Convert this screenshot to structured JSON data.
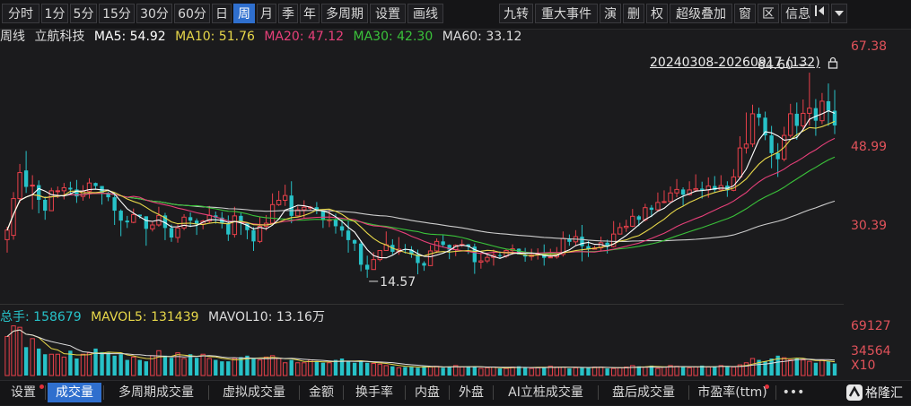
{
  "toolbar": {
    "left_items": [
      "分时",
      "1分",
      "5分",
      "15分",
      "30分",
      "60分",
      "日",
      "周",
      "月",
      "季",
      "年",
      "多周期",
      "设置",
      "画线"
    ],
    "active": "周",
    "right_items": [
      "九转",
      "重大事件",
      "演",
      "删",
      "权",
      "超级叠加",
      "窗",
      "区",
      "信息"
    ]
  },
  "legend": {
    "period": "周线",
    "name": "立航科技",
    "ma5": "MA5: 54.92",
    "ma10": "MA10: 51.76",
    "ma20": "MA20: 47.12",
    "ma30": "MA30: 42.30",
    "ma60": "MA60: 33.12"
  },
  "range_label": "20240308-20260917 (132)",
  "price_axis": [
    "67.38",
    "48.99",
    "30.39"
  ],
  "annotations": {
    "high": "64.60",
    "low": "14.57"
  },
  "volume": {
    "total": "总手: 158679",
    "mavol5": "MAVOL5: 131439",
    "mavol10": "MAVOL10: 13.16万",
    "axis": [
      "69127",
      "34564",
      "X10"
    ]
  },
  "bottom_tabs": [
    "设置",
    "成交量",
    "多周期成交量",
    "虚拟成交量",
    "金额",
    "换手率",
    "内盘",
    "外盘",
    "AI立桩成交量",
    "盘后成交量",
    "市盈率(ttm)",
    "•••"
  ],
  "bottom_active": "成交量",
  "logo_text": "格隆汇",
  "colors": {
    "up": "#e8404a",
    "down": "#27c2c8",
    "ma5": "#ffffff",
    "ma10": "#e8d84a",
    "ma20": "#e8407a",
    "ma30": "#3ac23a",
    "ma60": "#cccccc"
  },
  "chart_data": {
    "type": "candlestick",
    "ylim": [
      12,
      70
    ],
    "x_count": 132,
    "points": [
      [
        0,
        26.0,
        28.2,
        23.0,
        29.0
      ],
      [
        1,
        27.0,
        35.5,
        26.0,
        37.0
      ],
      [
        2,
        35.5,
        41.5,
        34.5,
        43.5
      ],
      [
        3,
        42.0,
        38.2,
        36.8,
        46.5
      ],
      [
        4,
        38.6,
        38.6,
        33.0,
        40.9
      ],
      [
        5,
        38.6,
        35.2,
        32.1,
        39.7
      ],
      [
        6,
        35.2,
        32.7,
        30.6,
        36.0
      ],
      [
        7,
        32.7,
        37.3,
        32.6,
        38.0
      ],
      [
        8,
        37.3,
        37.3,
        35.6,
        38.3
      ],
      [
        9,
        37.3,
        38.0,
        35.3,
        39.1
      ],
      [
        10,
        38.0,
        37.6,
        36.7,
        39.4
      ],
      [
        11,
        37.6,
        36.0,
        34.5,
        39.8
      ],
      [
        12,
        36.0,
        37.2,
        35.0,
        38.6
      ],
      [
        13,
        37.2,
        39.1,
        35.5,
        40.2
      ],
      [
        14,
        39.1,
        38.4,
        37.8,
        39.2
      ],
      [
        15,
        38.4,
        36.8,
        34.1,
        37.0
      ],
      [
        16,
        36.8,
        35.8,
        34.9,
        37.1
      ],
      [
        17,
        35.8,
        32.7,
        29.4,
        36.9
      ],
      [
        18,
        32.7,
        30.4,
        26.8,
        33.0
      ],
      [
        19,
        30.4,
        30.0,
        28.7,
        31.5
      ],
      [
        20,
        30.0,
        31.8,
        29.8,
        33.2
      ],
      [
        21,
        31.8,
        31.4,
        30.9,
        31.5
      ],
      [
        22,
        31.4,
        28.5,
        24.6,
        31.4
      ],
      [
        23,
        28.5,
        29.4,
        27.9,
        30.1
      ],
      [
        24,
        29.4,
        31.6,
        29.0,
        33.6
      ],
      [
        25,
        31.6,
        28.7,
        25.9,
        32.2
      ],
      [
        26,
        28.7,
        26.5,
        25.5,
        29.5
      ],
      [
        27,
        26.5,
        28.7,
        25.3,
        29.5
      ],
      [
        28,
        28.7,
        31.2,
        28.2,
        31.9
      ],
      [
        29,
        31.2,
        30.4,
        28.9,
        32.3
      ],
      [
        30,
        30.4,
        29.6,
        27.1,
        30.9
      ],
      [
        31,
        29.6,
        30.3,
        28.4,
        30.6
      ],
      [
        32,
        30.3,
        31.6,
        29.7,
        33.8
      ],
      [
        33,
        31.6,
        31.1,
        29.7,
        32.5
      ],
      [
        34,
        31.1,
        29.8,
        28.6,
        32.4
      ],
      [
        35,
        29.8,
        27.2,
        25.7,
        31.6
      ],
      [
        36,
        27.2,
        31.5,
        26.5,
        33.6
      ],
      [
        37,
        31.5,
        29.8,
        27.1,
        32.2
      ],
      [
        38,
        29.8,
        28.2,
        26.1,
        30.0
      ],
      [
        39,
        28.2,
        25.6,
        23.4,
        28.9
      ],
      [
        40,
        25.6,
        29.1,
        25.2,
        31.2
      ],
      [
        41,
        29.1,
        29.8,
        28.1,
        31.7
      ],
      [
        42,
        29.8,
        34.1,
        29.5,
        36.7
      ],
      [
        43,
        34.1,
        35.1,
        33.8,
        37.3
      ],
      [
        44,
        35.1,
        36.2,
        33.8,
        38.7
      ],
      [
        45,
        36.2,
        31.5,
        29.8,
        39.5
      ],
      [
        46,
        31.5,
        32.9,
        31.3,
        33.7
      ],
      [
        47,
        32.9,
        33.5,
        31.0,
        35.1
      ],
      [
        48,
        33.5,
        33.5,
        32.6,
        33.8
      ],
      [
        49,
        33.5,
        32.8,
        31.9,
        34.7
      ],
      [
        50,
        32.8,
        30.5,
        28.7,
        31.6
      ],
      [
        51,
        30.5,
        30.6,
        28.9,
        33.0
      ],
      [
        52,
        30.6,
        29.1,
        27.4,
        32.0
      ],
      [
        53,
        29.1,
        28.1,
        26.7,
        30.6
      ],
      [
        54,
        28.1,
        25.9,
        23.0,
        30.5
      ],
      [
        55,
        25.9,
        25.1,
        23.4,
        26.1
      ],
      [
        56,
        25.1,
        20.2,
        18.7,
        25.8
      ],
      [
        57,
        20.2,
        19.1,
        17.2,
        22.3
      ],
      [
        58,
        19.1,
        21.4,
        20.1,
        23.1
      ],
      [
        59,
        21.4,
        23.5,
        21.0,
        23.6
      ],
      [
        60,
        23.5,
        24.8,
        24.3,
        27.9
      ],
      [
        61,
        24.8,
        23.2,
        22.6,
        26.1
      ],
      [
        62,
        23.2,
        23.8,
        22.5,
        26.6
      ],
      [
        63,
        23.8,
        23.7,
        22.8,
        25.0
      ],
      [
        64,
        23.7,
        22.6,
        21.8,
        24.5
      ],
      [
        65,
        22.6,
        20.6,
        18.0,
        23.7
      ],
      [
        66,
        20.6,
        20.0,
        18.8,
        21.0
      ],
      [
        67,
        20.0,
        23.4,
        19.9,
        24.7
      ],
      [
        68,
        23.4,
        25.6,
        22.9,
        26.3
      ],
      [
        69,
        25.6,
        24.8,
        24.2,
        27.0
      ],
      [
        70,
        24.8,
        23.7,
        21.5,
        24.9
      ],
      [
        71,
        23.7,
        24.7,
        22.2,
        24.9
      ],
      [
        72,
        24.7,
        24.9,
        24.3,
        26.0
      ],
      [
        73,
        24.9,
        24.4,
        22.7,
        25.0
      ],
      [
        74,
        24.4,
        20.8,
        18.1,
        25.1
      ],
      [
        75,
        20.8,
        21.1,
        19.3,
        22.9
      ],
      [
        76,
        21.1,
        21.9,
        20.6,
        22.6
      ],
      [
        77,
        21.9,
        22.4,
        20.0,
        23.7
      ],
      [
        78,
        22.4,
        22.2,
        21.6,
        23.3
      ],
      [
        79,
        22.2,
        23.5,
        21.8,
        23.8
      ],
      [
        80,
        23.5,
        23.9,
        22.5,
        24.9
      ],
      [
        81,
        23.9,
        22.6,
        22.6,
        24.0
      ],
      [
        82,
        22.6,
        22.1,
        20.9,
        24.1
      ],
      [
        83,
        22.1,
        22.5,
        21.2,
        23.9
      ],
      [
        84,
        22.5,
        22.7,
        21.4,
        24.0
      ],
      [
        85,
        22.7,
        21.8,
        20.0,
        24.9
      ],
      [
        86,
        21.8,
        22.0,
        21.8,
        23.9
      ],
      [
        87,
        22.0,
        22.6,
        21.6,
        24.3
      ],
      [
        88,
        22.6,
        26.3,
        22.1,
        27.9
      ],
      [
        89,
        26.3,
        25.5,
        24.6,
        27.2
      ],
      [
        90,
        25.5,
        26.7,
        24.6,
        28.2
      ],
      [
        91,
        26.7,
        24.5,
        21.0,
        29.4
      ],
      [
        92,
        24.5,
        23.8,
        22.0,
        25.7
      ],
      [
        93,
        23.8,
        24.1,
        23.7,
        24.6
      ],
      [
        94,
        24.1,
        25.3,
        23.5,
        26.7
      ],
      [
        95,
        25.3,
        24.4,
        22.8,
        26.0
      ],
      [
        96,
        24.4,
        27.3,
        24.2,
        30.3
      ],
      [
        97,
        27.3,
        28.8,
        27.2,
        29.9
      ],
      [
        98,
        28.8,
        29.1,
        27.8,
        30.6
      ],
      [
        99,
        29.1,
        31.4,
        28.9,
        33.1
      ],
      [
        100,
        31.4,
        30.6,
        29.1,
        31.7
      ],
      [
        101,
        30.6,
        33.4,
        30.2,
        34.3
      ],
      [
        102,
        33.4,
        32.9,
        31.2,
        34.0
      ],
      [
        103,
        32.9,
        34.6,
        32.5,
        36.9
      ],
      [
        104,
        34.6,
        34.8,
        34.4,
        37.4
      ],
      [
        105,
        34.8,
        36.8,
        34.6,
        38.3
      ],
      [
        106,
        36.8,
        37.6,
        35.8,
        40.0
      ],
      [
        107,
        37.6,
        36.4,
        33.9,
        38.1
      ],
      [
        108,
        36.4,
        37.5,
        36.2,
        39.5
      ],
      [
        109,
        37.5,
        37.8,
        37.0,
        41.1
      ],
      [
        110,
        37.8,
        37.5,
        35.5,
        39.4
      ],
      [
        111,
        37.5,
        38.4,
        35.7,
        40.4
      ],
      [
        112,
        38.4,
        37.5,
        36.9,
        40.7
      ],
      [
        113,
        37.5,
        38.5,
        37.1,
        40.9
      ],
      [
        114,
        38.5,
        37.4,
        35.9,
        39.5
      ],
      [
        115,
        37.4,
        40.5,
        37.2,
        42.3
      ],
      [
        116,
        40.5,
        47.2,
        40.1,
        49.9
      ],
      [
        117,
        47.2,
        48.1,
        45.9,
        55.4
      ],
      [
        118,
        48.1,
        55.1,
        47.4,
        57.2
      ],
      [
        119,
        55.1,
        54.2,
        52.3,
        56.5
      ],
      [
        120,
        54.2,
        50.1,
        49.0,
        55.6
      ],
      [
        121,
        50.1,
        46.0,
        42.5,
        52.3
      ],
      [
        122,
        46.0,
        44.6,
        40.5,
        48.3
      ],
      [
        123,
        44.6,
        50.1,
        44.1,
        52.1
      ],
      [
        124,
        50.1,
        55.1,
        49.6,
        57.4
      ],
      [
        125,
        55.1,
        52.3,
        49.1,
        57.7
      ],
      [
        126,
        52.3,
        55.2,
        51.2,
        58.4
      ],
      [
        127,
        55.2,
        56.4,
        52.4,
        64.6
      ],
      [
        128,
        56.4,
        53.5,
        50.0,
        58.5
      ],
      [
        129,
        53.5,
        58.0,
        52.7,
        59.9
      ],
      [
        130,
        58.0,
        55.8,
        52.3,
        62.1
      ],
      [
        131,
        55.8,
        52.4,
        50.4,
        60.6
      ]
    ],
    "volumes": [
      55,
      70,
      68,
      40,
      52,
      38,
      30,
      30,
      30,
      26,
      35,
      24,
      30,
      32,
      38,
      33,
      32,
      28,
      30,
      22,
      26,
      22,
      20,
      28,
      35,
      28,
      25,
      32,
      24,
      30,
      25,
      30,
      24,
      22,
      20,
      20,
      24,
      26,
      28,
      24,
      22,
      26,
      28,
      24,
      18,
      22,
      18,
      18,
      22,
      20,
      18,
      18,
      22,
      24,
      20,
      18,
      20,
      18,
      17,
      16,
      14,
      13,
      11,
      12,
      13,
      11,
      13,
      12,
      13,
      11,
      12,
      14,
      12,
      13,
      12,
      10,
      11,
      12,
      10,
      10,
      12,
      13,
      12,
      10,
      11,
      12,
      13,
      12,
      12,
      10,
      11,
      12,
      11,
      12,
      12,
      10,
      10,
      11,
      12,
      14,
      13,
      12,
      14,
      10,
      12,
      14,
      13,
      12,
      11,
      12,
      14,
      12,
      13,
      14,
      12,
      12,
      15,
      18,
      24,
      22,
      20,
      24,
      28,
      25,
      22,
      24,
      22,
      20,
      18,
      22,
      20,
      17
    ],
    "ma5": "MA5: 54.92",
    "ma10": "MA10: 51.76",
    "ma20": "MA20: 47.12",
    "ma30": "MA30: 42.30",
    "ma60": "MA60: 33.12"
  }
}
